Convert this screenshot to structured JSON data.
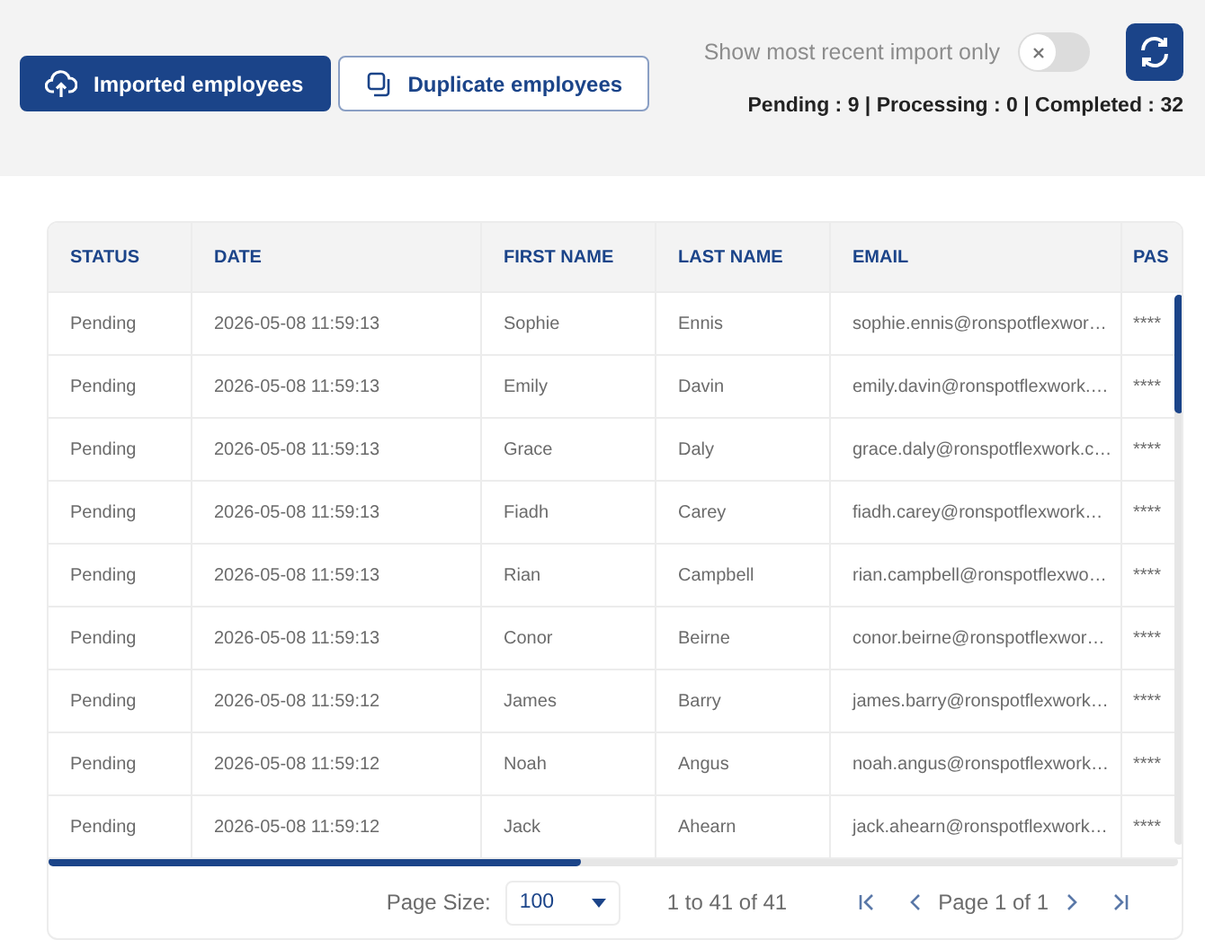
{
  "tabs": [
    {
      "label": "Imported employees",
      "selected": true
    },
    {
      "label": "Duplicate employees",
      "selected": false
    }
  ],
  "toggle": {
    "label": "Show most recent import only",
    "on": false
  },
  "stats": "Pending : 9 | Processing : 0 | Completed : 32",
  "table": {
    "columns": [
      "STATUS",
      "DATE",
      "FIRST NAME",
      "LAST NAME",
      "EMAIL",
      "PAS"
    ],
    "rows": [
      [
        "Pending",
        "2026-05-08 11:59:13",
        "Sophie",
        "Ennis",
        "sophie.ennis@ronspotflexwor…",
        "****"
      ],
      [
        "Pending",
        "2026-05-08 11:59:13",
        "Emily",
        "Davin",
        "emily.davin@ronspotflexwork.…",
        "****"
      ],
      [
        "Pending",
        "2026-05-08 11:59:13",
        "Grace",
        "Daly",
        "grace.daly@ronspotflexwork.c…",
        "****"
      ],
      [
        "Pending",
        "2026-05-08 11:59:13",
        "Fiadh",
        "Carey",
        "fiadh.carey@ronspotflexwork…",
        "****"
      ],
      [
        "Pending",
        "2026-05-08 11:59:13",
        "Rian",
        "Campbell",
        "rian.campbell@ronspotflexwo…",
        "****"
      ],
      [
        "Pending",
        "2026-05-08 11:59:13",
        "Conor",
        "Beirne",
        "conor.beirne@ronspotflexwor…",
        "****"
      ],
      [
        "Pending",
        "2026-05-08 11:59:12",
        "James",
        "Barry",
        "james.barry@ronspotflexwork…",
        "****"
      ],
      [
        "Pending",
        "2026-05-08 11:59:12",
        "Noah",
        "Angus",
        "noah.angus@ronspotflexwork…",
        "****"
      ],
      [
        "Pending",
        "2026-05-08 11:59:12",
        "Jack",
        "Ahearn",
        "jack.ahearn@ronspotflexwork…",
        "****"
      ]
    ]
  },
  "pagination": {
    "page_size_label": "Page Size:",
    "page_size": "100",
    "range": "1 to 41 of 41",
    "page": "Page 1 of 1"
  }
}
